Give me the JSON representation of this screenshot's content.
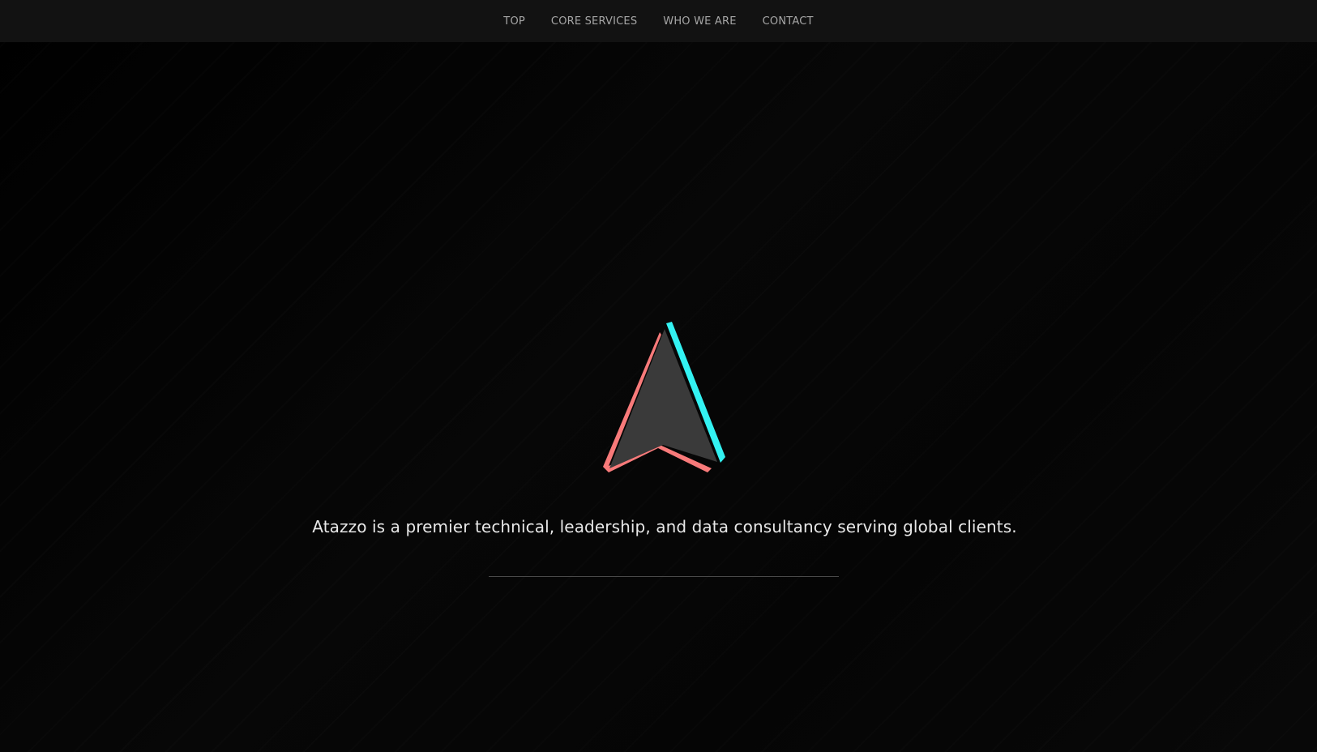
{
  "nav": {
    "items": [
      {
        "label": "TOP"
      },
      {
        "label": "CORE SERVICES"
      },
      {
        "label": "WHO WE ARE"
      },
      {
        "label": "CONTACT"
      }
    ]
  },
  "hero": {
    "logo_icon": "arrow-logo-icon",
    "tagline": "Atazzo is a premier technical, leadership, and data consultancy serving global clients."
  },
  "colors": {
    "background": "#050505",
    "nav_background": "#121212",
    "nav_text": "#a6a6a6",
    "tagline_text": "#e8e8e8",
    "logo_fill": "#3a3a3a",
    "logo_accent_cyan": "#33f2f2",
    "logo_accent_coral": "#f87a7a"
  }
}
